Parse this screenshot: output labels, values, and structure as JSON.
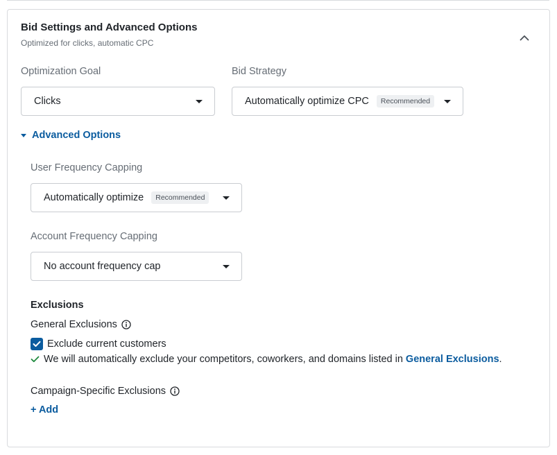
{
  "panel": {
    "title": "Bid Settings and Advanced Options",
    "subtitle": "Optimized for clicks, automatic CPC"
  },
  "optimization_goal": {
    "label": "Optimization Goal",
    "value": "Clicks"
  },
  "bid_strategy": {
    "label": "Bid Strategy",
    "value": "Automatically optimize CPC",
    "badge": "Recommended"
  },
  "advanced_options": {
    "label": "Advanced Options",
    "expanded": true
  },
  "user_frequency": {
    "label": "User Frequency Capping",
    "value": "Automatically optimize",
    "badge": "Recommended"
  },
  "account_frequency": {
    "label": "Account Frequency Capping",
    "value": "No account frequency cap"
  },
  "exclusions": {
    "heading": "Exclusions",
    "general_label": "General Exclusions",
    "checkbox_label": "Exclude current customers",
    "checkbox_checked": true,
    "note_text": "We will automatically exclude your competitors, coworkers, and domains listed in ",
    "note_link": "General Exclusions",
    "note_end": ".",
    "campaign_label": "Campaign-Specific Exclusions",
    "add_label": "+ Add"
  },
  "colors": {
    "accent": "#0b5c9f",
    "check_green": "#1e8a3e",
    "border": "#c9ccd1"
  },
  "icons": {
    "collapse": "chevron-up-icon",
    "dropdown": "caret-down-icon",
    "info": "info-icon",
    "check": "check-icon"
  }
}
